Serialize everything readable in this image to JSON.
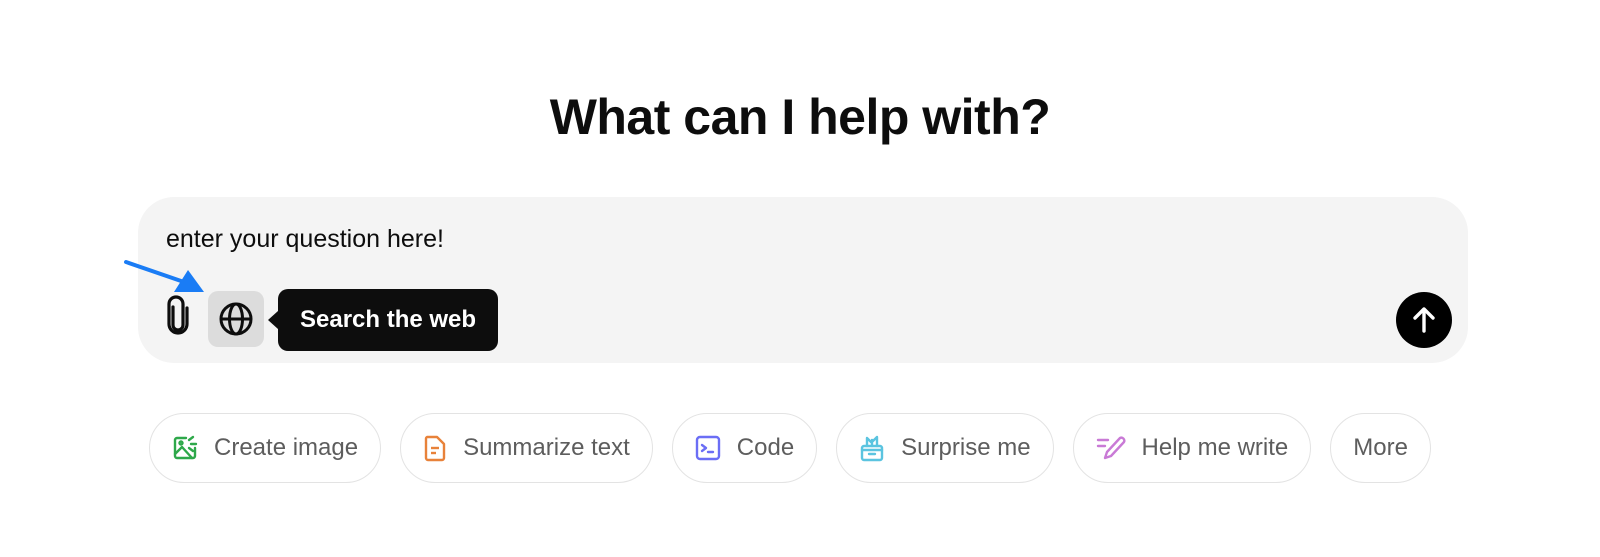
{
  "header": {
    "title": "What can I help with?"
  },
  "composer": {
    "input_value": "enter your question here!",
    "attach_icon": "paperclip-icon",
    "search_icon": "globe-icon",
    "tooltip": "Search the web",
    "send_icon": "arrow-up-icon"
  },
  "annotation": {
    "arrow_color": "#1a7cf5"
  },
  "suggestions": [
    {
      "label": "Create image",
      "icon": "image-icon",
      "color": "#2ea84a"
    },
    {
      "label": "Summarize text",
      "icon": "document-icon",
      "color": "#e8823a"
    },
    {
      "label": "Code",
      "icon": "terminal-icon",
      "color": "#6b6ef5"
    },
    {
      "label": "Surprise me",
      "icon": "gift-icon",
      "color": "#5bc4e0"
    },
    {
      "label": "Help me write",
      "icon": "pen-icon",
      "color": "#c97ad6"
    },
    {
      "label": "More",
      "icon": "",
      "color": ""
    }
  ]
}
